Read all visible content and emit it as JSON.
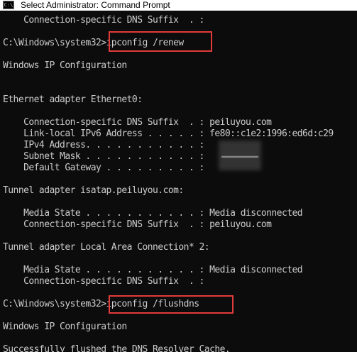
{
  "window": {
    "title": "Select Administrator: Command Prompt",
    "icon": "cmd-icon"
  },
  "highlight_color": "#e23b3b",
  "console": {
    "lines": [
      "    Connection-specific DNS Suffix  . :",
      "",
      "C:\\Windows\\system32>ipconfig /renew",
      "",
      "Windows IP Configuration",
      "",
      "",
      "Ethernet adapter Ethernet0:",
      "",
      "    Connection-specific DNS Suffix  . : peiluyou.com",
      "    Link-local IPv6 Address . . . . . : fe80::c1e2:1996:ed6d:c29",
      "    IPv4 Address. . . . . . . . . . . :",
      "    Subnet Mask . . . . . . . . . . . :",
      "    Default Gateway . . . . . . . . . :",
      "",
      "Tunnel adapter isatap.peiluyou.com:",
      "",
      "    Media State . . . . . . . . . . . : Media disconnected",
      "    Connection-specific DNS Suffix  . : peiluyou.com",
      "",
      "Tunnel adapter Local Area Connection* 2:",
      "",
      "    Media State . . . . . . . . . . . : Media disconnected",
      "    Connection-specific DNS Suffix  . :",
      "",
      "C:\\Windows\\system32>ipconfig /flushdns",
      "",
      "Windows IP Configuration",
      "",
      "Successfully flushed the DNS Resolver Cache."
    ]
  }
}
